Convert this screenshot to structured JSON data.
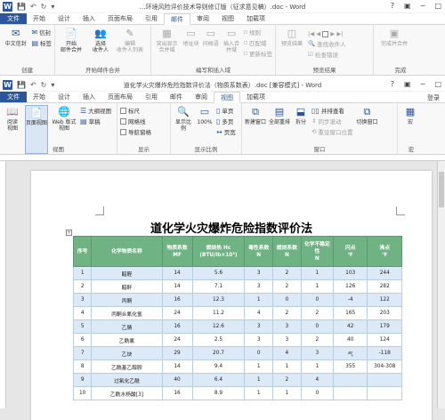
{
  "w1": {
    "title": "…环境风险评价技术导则修订版（征求意见稿）.doc - Word",
    "tabs": [
      "文件",
      "开始",
      "设计",
      "插入",
      "页面布局",
      "引用",
      "邮件",
      "审阅",
      "视图",
      "加载项"
    ],
    "active_tab": "邮件",
    "groups": {
      "create": {
        "label": "创建",
        "zh_env": "中文信封",
        "env": "信封",
        "lbl": "标签"
      },
      "start": {
        "label": "开始邮件合并",
        "start_merge": "开始\n邮件合并",
        "select": "选择\n收件人",
        "edit": "编辑\n收件人列表"
      },
      "write": {
        "label": "编写和插入域",
        "highlight": "突出显示\n合并域",
        "addr": "地址块",
        "greet": "问候语",
        "insert": "插入合并域",
        "rules": "规则",
        "match": "匹配域",
        "update": "更新标签"
      },
      "preview": {
        "label": "预览结果",
        "preview": "预览结果",
        "find": "查找收件人",
        "check": "检查错误"
      },
      "finish": {
        "label": "完成",
        "finish": "完成并合并"
      }
    }
  },
  "w2": {
    "title": "道化学火灾爆炸危险指数评价法（物质系数表）.doc [兼容模式] - Word",
    "tabs": [
      "文件",
      "开始",
      "设计",
      "插入",
      "页面布局",
      "引用",
      "邮件",
      "审阅",
      "视图",
      "加载项"
    ],
    "active_tab": "视图",
    "login": "登录",
    "groups": {
      "views": {
        "label": "视图",
        "read": "阅读\n视图",
        "print": "页面视图",
        "web": "Web 版式视图",
        "outline": "大纲视图",
        "draft": "草稿"
      },
      "show": {
        "label": "显示",
        "ruler": "标尺",
        "grid": "网格线",
        "nav": "导航窗格"
      },
      "zoom": {
        "label": "显示比例",
        "zoom": "显示比例",
        "pct": "100%",
        "one": "单页",
        "multi": "多页",
        "width": "页宽"
      },
      "window": {
        "label": "窗口",
        "new": "新建窗口",
        "arrange": "全部重排",
        "split": "拆分",
        "side": "并排查看",
        "sync": "同步滚动",
        "reset": "重设窗口位置",
        "switch": "切换窗口"
      },
      "macro": {
        "label": "宏",
        "macro": "宏"
      }
    }
  },
  "document": {
    "title": "道化学火灾爆炸危险指数评价法",
    "headers": [
      "序号",
      "化学物质名称",
      "物质系数\nMF",
      "燃烧热 Hc\n(BTU/lb×10³)",
      "毒性系数\nN",
      "燃烧系数\nN",
      "化学不稳定性\nN",
      "闪点\n℉",
      "沸点\n℉"
    ],
    "rows": [
      [
        "1",
        "醋醛",
        "14",
        "5.6",
        "3",
        "2",
        "1",
        "103",
        "244"
      ],
      [
        "2",
        "醋酐",
        "14",
        "7.1",
        "3",
        "2",
        "1",
        "126",
        "282"
      ],
      [
        "3",
        "丙酮",
        "16",
        "12.3",
        "1",
        "0",
        "0",
        "-4",
        "122"
      ],
      [
        "4",
        "丙酮合氰化氢",
        "24",
        "11.2",
        "4",
        "2",
        "2",
        "165",
        "203"
      ],
      [
        "5",
        "乙腈",
        "16",
        "12.6",
        "3",
        "3",
        "0",
        "42",
        "179"
      ],
      [
        "6",
        "乙酰氯",
        "24",
        "2.5",
        "3",
        "3",
        "2",
        "40",
        "124"
      ],
      [
        "7",
        "乙炔",
        "29",
        "20.7",
        "0",
        "4",
        "3",
        "气",
        "-118"
      ],
      [
        "8",
        "乙酰基乙醇胺",
        "14",
        "9.4",
        "1",
        "1",
        "1",
        "355",
        "304-308"
      ],
      [
        "9",
        "过氧化乙酰",
        "40",
        "6.4",
        "1",
        "2",
        "4",
        "",
        ""
      ],
      [
        "10",
        "乙酰水杨酸[3]",
        "16",
        "8.9",
        "1",
        "1",
        "0",
        "",
        ""
      ]
    ]
  }
}
